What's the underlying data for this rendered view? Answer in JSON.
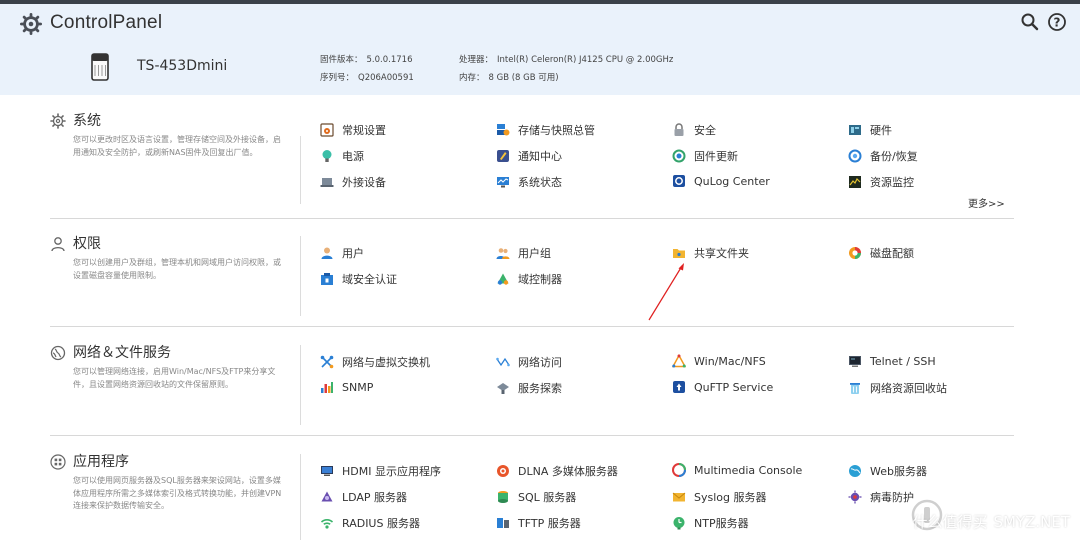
{
  "header": {
    "title": "ControlPanel",
    "device_name": "TS-453Dmini",
    "firmware_label": "固件版本：",
    "firmware_value": "5.0.0.1716",
    "serial_label": "序列号：",
    "serial_value": "Q206A00591",
    "cpu_label": "处理器：",
    "cpu_value": "Intel(R) Celeron(R) J4125 CPU @ 2.00GHz",
    "memory_label": "内存：",
    "memory_value": "8 GB (8 GB 可用)"
  },
  "sections": [
    {
      "title": "系统",
      "description": "您可以更改时区及语言设置，管理存储空间及外接设备，启用通知及安全防护，或刷新NAS固件及回复出厂值。",
      "items": [
        {
          "label": "常规设置",
          "icon": "settings-icon"
        },
        {
          "label": "存储与快照总管",
          "icon": "storage-icon"
        },
        {
          "label": "安全",
          "icon": "lock-icon"
        },
        {
          "label": "硬件",
          "icon": "hardware-icon"
        },
        {
          "label": "电源",
          "icon": "power-bulb-icon"
        },
        {
          "label": "通知中心",
          "icon": "notification-icon"
        },
        {
          "label": "固件更新",
          "icon": "firmware-update-icon"
        },
        {
          "label": "备份/恢复",
          "icon": "backup-icon"
        },
        {
          "label": "外接设备",
          "icon": "external-device-icon"
        },
        {
          "label": "系统状态",
          "icon": "monitor-icon"
        },
        {
          "label": "QuLog Center",
          "icon": "qulog-icon"
        },
        {
          "label": "资源监控",
          "icon": "resource-monitor-icon"
        }
      ],
      "more": "更多>>"
    },
    {
      "title": "权限",
      "description": "您可以创建用户及群组，管理本机和网域用户访问权限，或设置磁盘容量使用限制。",
      "items": [
        {
          "label": "用户",
          "icon": "user-icon"
        },
        {
          "label": "用户组",
          "icon": "user-group-icon"
        },
        {
          "label": "共享文件夹",
          "icon": "shared-folder-icon"
        },
        {
          "label": "磁盘配额",
          "icon": "quota-pie-icon"
        },
        {
          "label": "域安全认证",
          "icon": "domain-security-icon"
        },
        {
          "label": "域控制器",
          "icon": "domain-controller-icon"
        }
      ]
    },
    {
      "title": "网络＆文件服务",
      "description": "您可以管理网络连接，启用Win/Mac/NFS及FTP来分享文件，且设置网络资源回收站的文件保留原则。",
      "items": [
        {
          "label": "网络与虚拟交换机",
          "icon": "network-switch-icon"
        },
        {
          "label": "网络访问",
          "icon": "network-access-icon"
        },
        {
          "label": "Win/Mac/NFS",
          "icon": "win-mac-nfs-icon"
        },
        {
          "label": "Telnet / SSH",
          "icon": "terminal-icon"
        },
        {
          "label": "SNMP",
          "icon": "snmp-chart-icon"
        },
        {
          "label": "服务探索",
          "icon": "service-discovery-icon"
        },
        {
          "label": "QuFTP Service",
          "icon": "ftp-icon"
        },
        {
          "label": "网络资源回收站",
          "icon": "recycle-bin-icon"
        }
      ]
    },
    {
      "title": "应用程序",
      "description": "您可以使用网页服务器及SQL服务器来架设网站，设置多媒体应用程序所需之多媒体索引及格式转换功能，并创建VPN连接来保护数据传输安全。",
      "items": [
        {
          "label": "HDMI 显示应用程序",
          "icon": "hdmi-display-icon"
        },
        {
          "label": "DLNA 多媒体服务器",
          "icon": "dlna-icon"
        },
        {
          "label": "Multimedia Console",
          "icon": "multimedia-icon"
        },
        {
          "label": "Web服务器",
          "icon": "web-globe-icon"
        },
        {
          "label": "LDAP 服务器",
          "icon": "ldap-icon"
        },
        {
          "label": "SQL 服务器",
          "icon": "database-icon"
        },
        {
          "label": "Syslog 服务器",
          "icon": "syslog-mail-icon"
        },
        {
          "label": "病毒防护",
          "icon": "antivirus-icon"
        },
        {
          "label": "RADIUS 服务器",
          "icon": "radius-wifi-icon"
        },
        {
          "label": "TFTP 服务器",
          "icon": "tftp-icon"
        },
        {
          "label": "NTP服务器",
          "icon": "ntp-icon"
        }
      ]
    }
  ],
  "watermark": "什么值得买",
  "watermark_sub": "SMYZ.NET",
  "colors": {
    "header_bg": "#eaf2fb",
    "top_strip": "#3b4149",
    "annotation_arrow": "#e02020",
    "divider": "#d8d8d8"
  }
}
